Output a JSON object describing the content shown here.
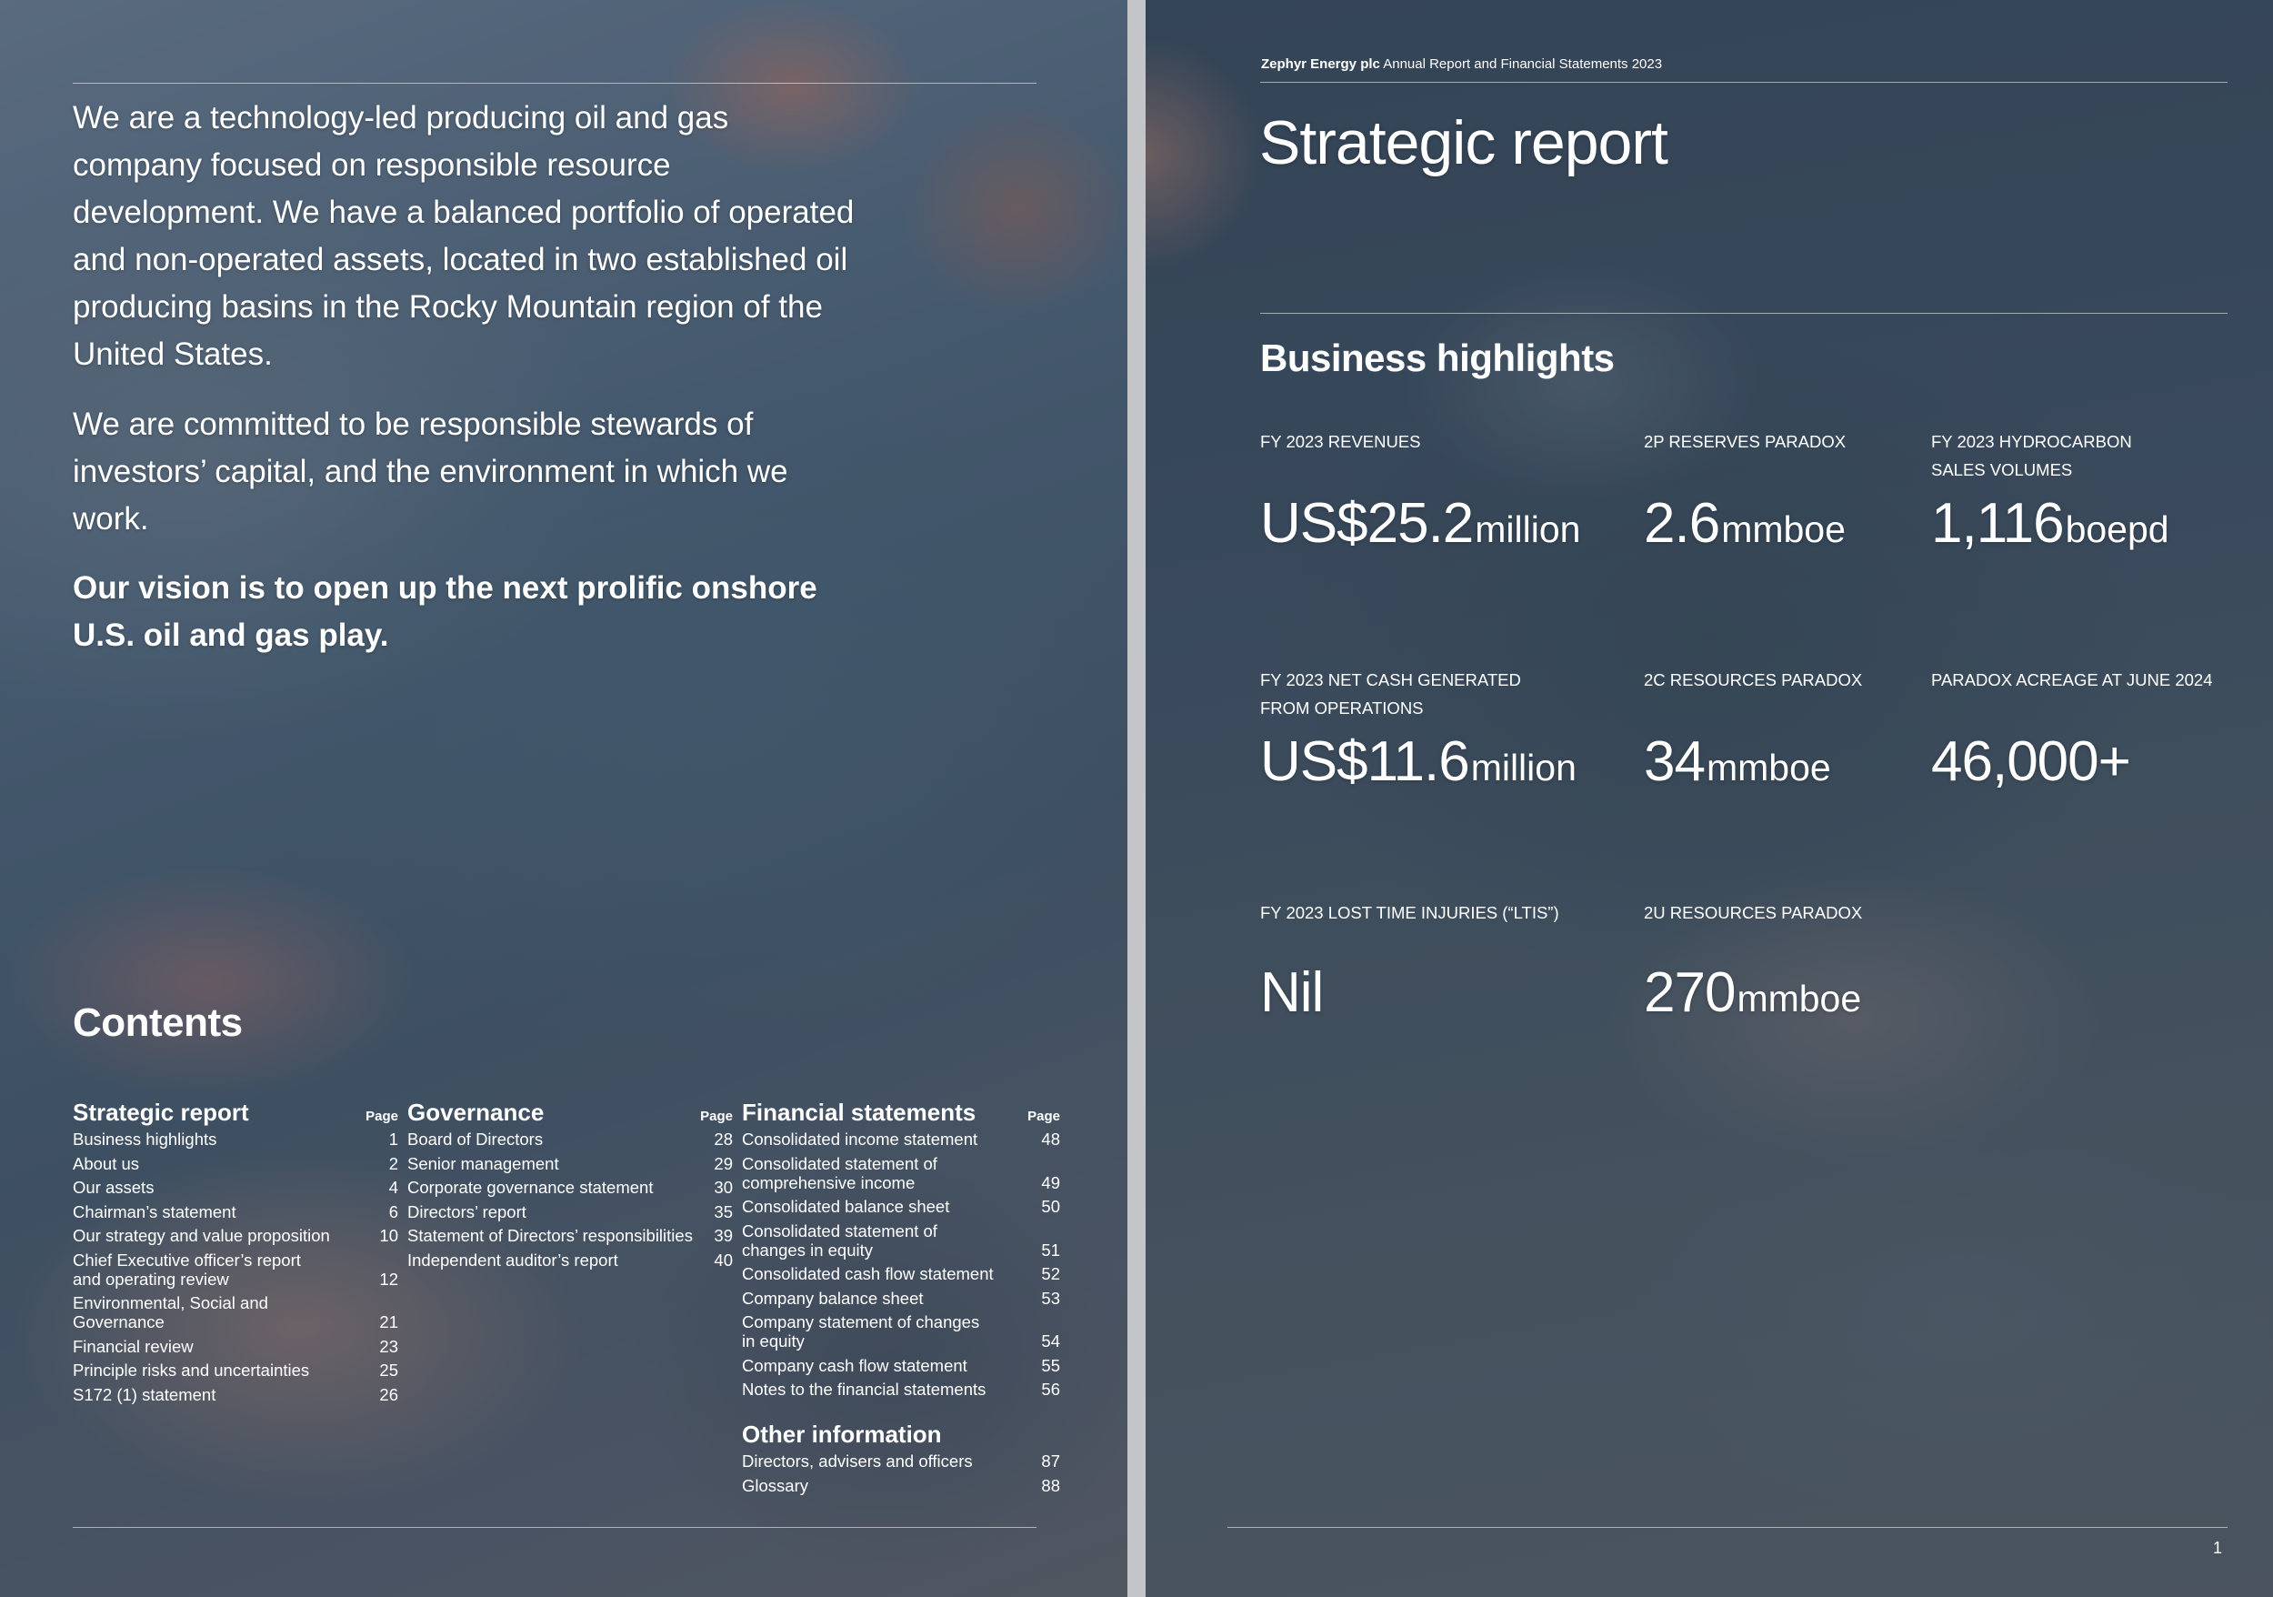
{
  "left_page": {
    "intro_paragraph_1": "We are a technology-led producing oil and gas company focused on responsible resource development. We have a balanced portfolio of operated and non-operated assets, located in two established oil producing basins in the Rocky Mountain region of the United States.",
    "intro_paragraph_2": "We are committed to be responsible stewards of investors’ capital, and the environment in which we work.",
    "vision_statement": "Our vision is to open up the next prolific onshore U.S. oil and gas play.",
    "contents": {
      "title": "Contents",
      "page_label": "Page",
      "sections": [
        {
          "title": "Strategic report",
          "items": [
            {
              "title": "Business highlights",
              "page": "1"
            },
            {
              "title": "About us",
              "page": "2"
            },
            {
              "title": "Our assets",
              "page": "4"
            },
            {
              "title": "Chairman’s statement",
              "page": "6"
            },
            {
              "title": "Our strategy and value proposition",
              "page": "10"
            },
            {
              "title": "Chief Executive officer’s report\nand operating review",
              "page": "12"
            },
            {
              "title": "Environmental, Social and Governance",
              "page": "21"
            },
            {
              "title": "Financial review",
              "page": "23"
            },
            {
              "title": "Principle risks and uncertainties",
              "page": "25"
            },
            {
              "title": "S172 (1) statement",
              "page": "26"
            }
          ]
        },
        {
          "title": "Governance",
          "items": [
            {
              "title": "Board of Directors",
              "page": "28"
            },
            {
              "title": "Senior management",
              "page": "29"
            },
            {
              "title": "Corporate governance statement",
              "page": "30"
            },
            {
              "title": "Directors’ report",
              "page": "35"
            },
            {
              "title": "Statement of Directors’ responsibilities",
              "page": "39"
            },
            {
              "title": "Independent auditor’s report",
              "page": "40"
            }
          ]
        },
        {
          "title": "Financial statements",
          "items": [
            {
              "title": "Consolidated income statement",
              "page": "48"
            },
            {
              "title": "Consolidated statement of\ncomprehensive income",
              "page": "49"
            },
            {
              "title": "Consolidated balance sheet",
              "page": "50"
            },
            {
              "title": "Consolidated statement of\nchanges in equity",
              "page": "51"
            },
            {
              "title": "Consolidated cash flow statement",
              "page": "52"
            },
            {
              "title": "Company balance sheet",
              "page": "53"
            },
            {
              "title": "Company statement of changes\nin equity",
              "page": "54"
            },
            {
              "title": "Company cash flow statement",
              "page": "55"
            },
            {
              "title": "Notes to the financial statements",
              "page": "56"
            }
          ]
        },
        {
          "title": "Other information",
          "items": [
            {
              "title": "Directors, advisers and officers",
              "page": "87"
            },
            {
              "title": "Glossary",
              "page": "88"
            }
          ]
        }
      ]
    }
  },
  "right_page": {
    "running_header_company": "Zephyr Energy plc",
    "running_header_rest": "Annual Report and Financial Statements 2023",
    "title": "Strategic report",
    "section_title": "Business highlights",
    "metrics": [
      {
        "label": "FY 2023 REVENUES",
        "value": "US$25.2",
        "unit": "million"
      },
      {
        "label": "2P RESERVES PARADOX",
        "value": "2.6",
        "unit": "mmboe"
      },
      {
        "label": "FY 2023 HYDROCARBON\nSALES VOLUMES",
        "value": "1,116",
        "unit": "boepd"
      },
      {
        "label": "FY 2023 NET CASH  GENERATED\nFROM  OPERATIONS",
        "value": "US$11.6",
        "unit": "million"
      },
      {
        "label": "2C RESOURCES PARADOX",
        "value": "34",
        "unit": "mmboe"
      },
      {
        "label": "PARADOX ACREAGE AT JUNE 2024",
        "value": "46,000+",
        "unit": ""
      },
      {
        "label": "FY 2023 LOST TIME INJURIES (“LTIs”)",
        "value": "Nil",
        "unit": ""
      },
      {
        "label": "2U RESOURCES PARADOX",
        "value": "270",
        "unit": "mmboe"
      }
    ],
    "page_number": "1"
  }
}
